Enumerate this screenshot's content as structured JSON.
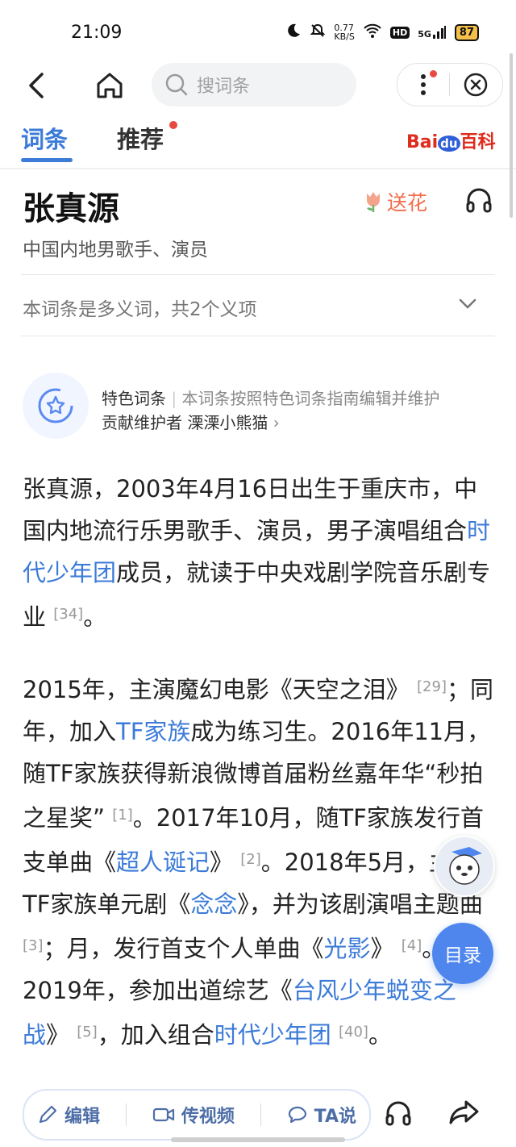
{
  "status": {
    "time": "21:09",
    "net_speed": "0.77\nKB/S",
    "net_speed_top": "0.77",
    "net_speed_bottom": "KB/S",
    "hd": "HD",
    "signal": "5G",
    "battery": "87"
  },
  "search": {
    "placeholder": "搜词条"
  },
  "tabs": [
    {
      "label": "词条"
    },
    {
      "label": "推荐"
    }
  ],
  "logo": {
    "bai": "Bai",
    "du": "du",
    "baike": "百科"
  },
  "entry": {
    "title": "张真源",
    "subtitle": "中国内地男歌手、演员",
    "flower_label": "送花",
    "polysemy": "本词条是多义词，共2个义项"
  },
  "feature": {
    "name": "特色词条",
    "divider": "|",
    "desc": "本词条按照特色词条指南编辑并维护",
    "contributor_label": "贡献维护者",
    "contributor": "溧溧小熊猫"
  },
  "para1": {
    "t1": "张真源，2003年4月16日出生于重庆市，中国内地流行乐男歌手、演员，男子演唱组合",
    "link1": "时代少年团",
    "t2": "成员，就读于中央戏剧学院音乐剧专业",
    "ref1": "[34]",
    "t3": "。"
  },
  "para2": {
    "t1": "2015年，主演魔幻电影《天空之泪》",
    "ref1": "[29]",
    "t2": "；同年，加入",
    "link1": "TF家族",
    "t3": "成为练习生。2016年11月，随TF家族获得新浪微博首届粉丝嘉年华“秒拍之星奖”",
    "ref2": "[1]",
    "t4": "。2017年10月，随TF家族发行首支单曲《",
    "link2": "超人诞记",
    "t5": "》",
    "ref3": "[2]",
    "t6": "。2018年5月，主演TF家族单元剧《",
    "link3": "念念",
    "t7": "》，并为该剧演唱主题曲",
    "ref4": "[3]",
    "t8": "；月，发行首支个人单曲《",
    "link4": "光影",
    "t9": "》",
    "ref5": "[4]",
    "t10": "。2019年，参加出道综艺《",
    "link5": "台风少年蜕变之战",
    "t11": "》",
    "ref6": "[5]",
    "t12": "，加入组合",
    "link6": "时代少年团",
    "ref7": "[40]",
    "t13": "。"
  },
  "toc": {
    "label": "目录"
  },
  "bottom": {
    "edit": "编辑",
    "video": "传视频",
    "ta": "TA说"
  },
  "colors": {
    "accent": "#3c7bd8",
    "flower": "#f26d4c",
    "toc_bg": "#4f86ee",
    "logo_red": "#e02a1c"
  }
}
